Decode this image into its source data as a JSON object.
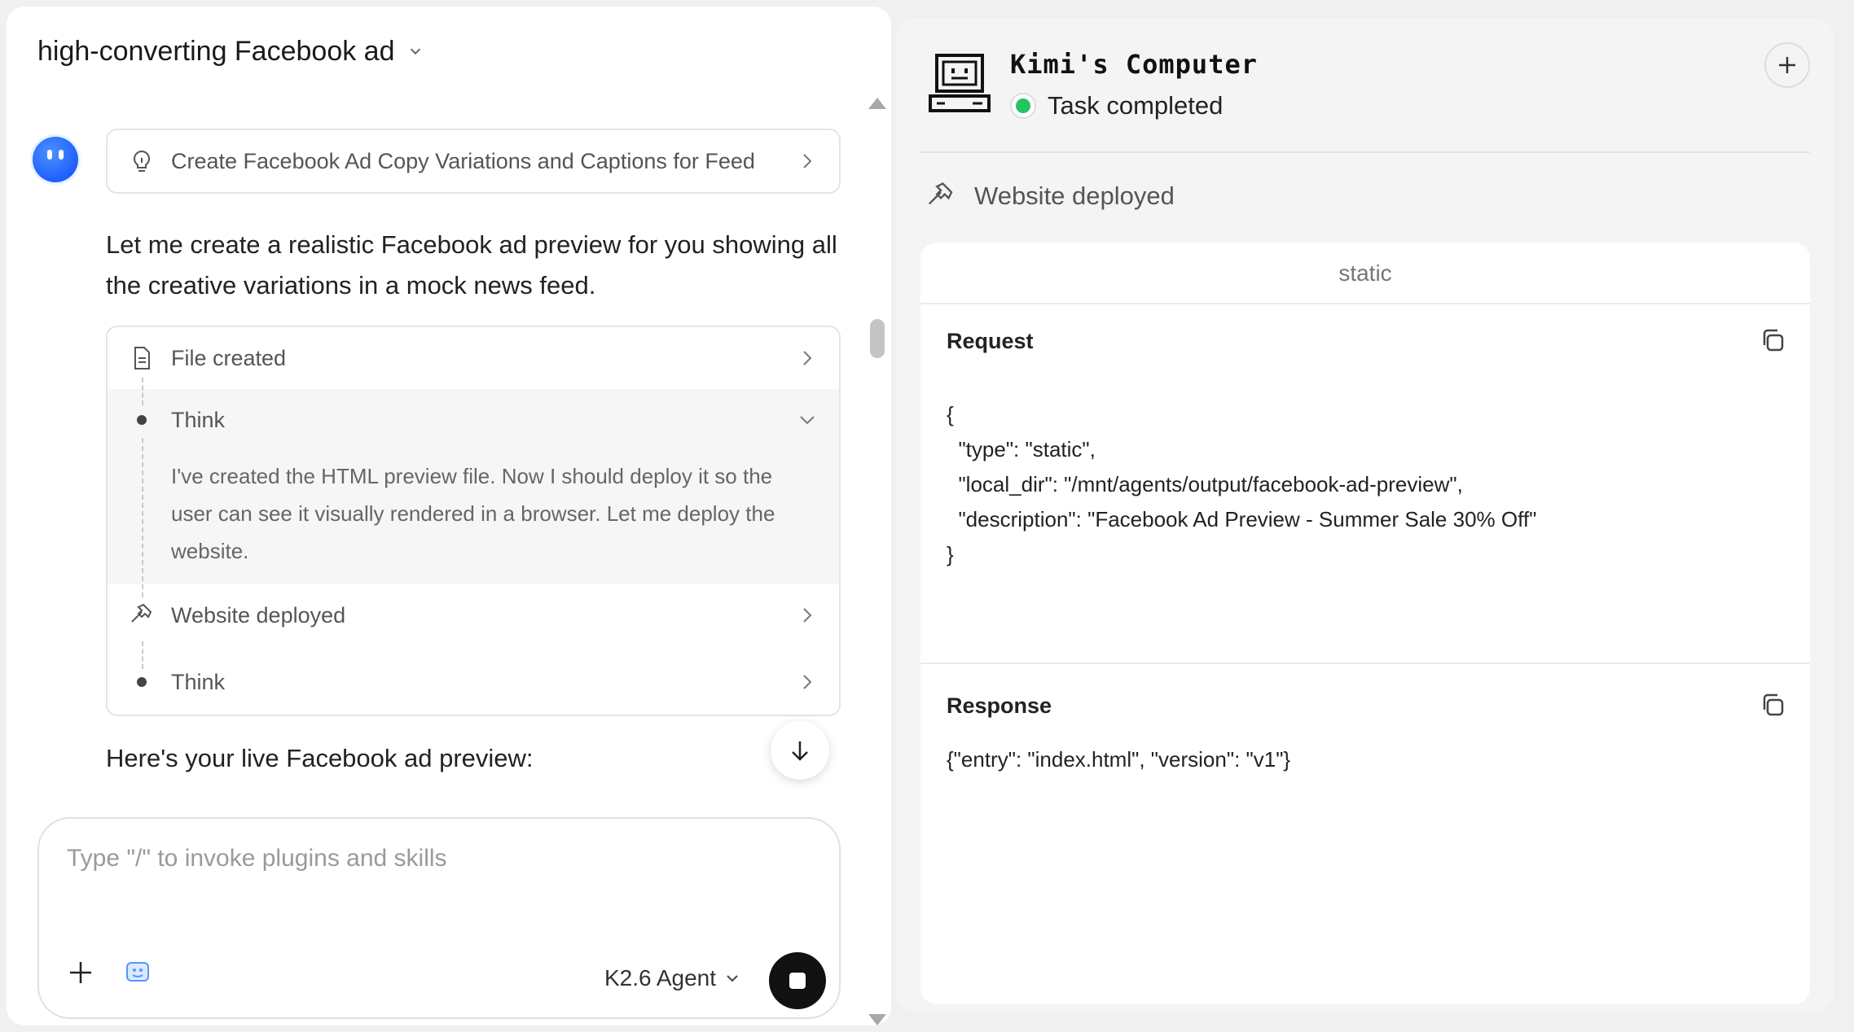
{
  "conversation": {
    "title": "high-converting Facebook ad",
    "plan_label": "Create Facebook Ad Copy Variations and Captions for Feed",
    "message": "Let me create a realistic Facebook ad preview for you showing all the creative variations in a mock news feed.",
    "steps": [
      {
        "label": "File created"
      },
      {
        "label": "Think",
        "text": "I've created the HTML preview file. Now I should deploy it so the user can see it visually rendered in a browser. Let me deploy the website."
      },
      {
        "label": "Website deployed"
      },
      {
        "label": "Think"
      }
    ],
    "followup": "Here's your live Facebook ad preview:"
  },
  "composer": {
    "placeholder": "Type \"/\" to invoke plugins and skills",
    "model": "K2.6 Agent"
  },
  "computer": {
    "title": "Kimi's Computer",
    "status": "Task completed",
    "status_color": "#22c45e",
    "action": "Website deployed",
    "tab": "static",
    "request_title": "Request",
    "request_body": "{\n  \"type\": \"static\",\n  \"local_dir\": \"/mnt/agents/output/facebook-ad-preview\",\n  \"description\": \"Facebook Ad Preview - Summer Sale 30% Off\"\n}",
    "response_title": "Response",
    "response_body": "{\"entry\": \"index.html\", \"version\": \"v1\"}"
  }
}
